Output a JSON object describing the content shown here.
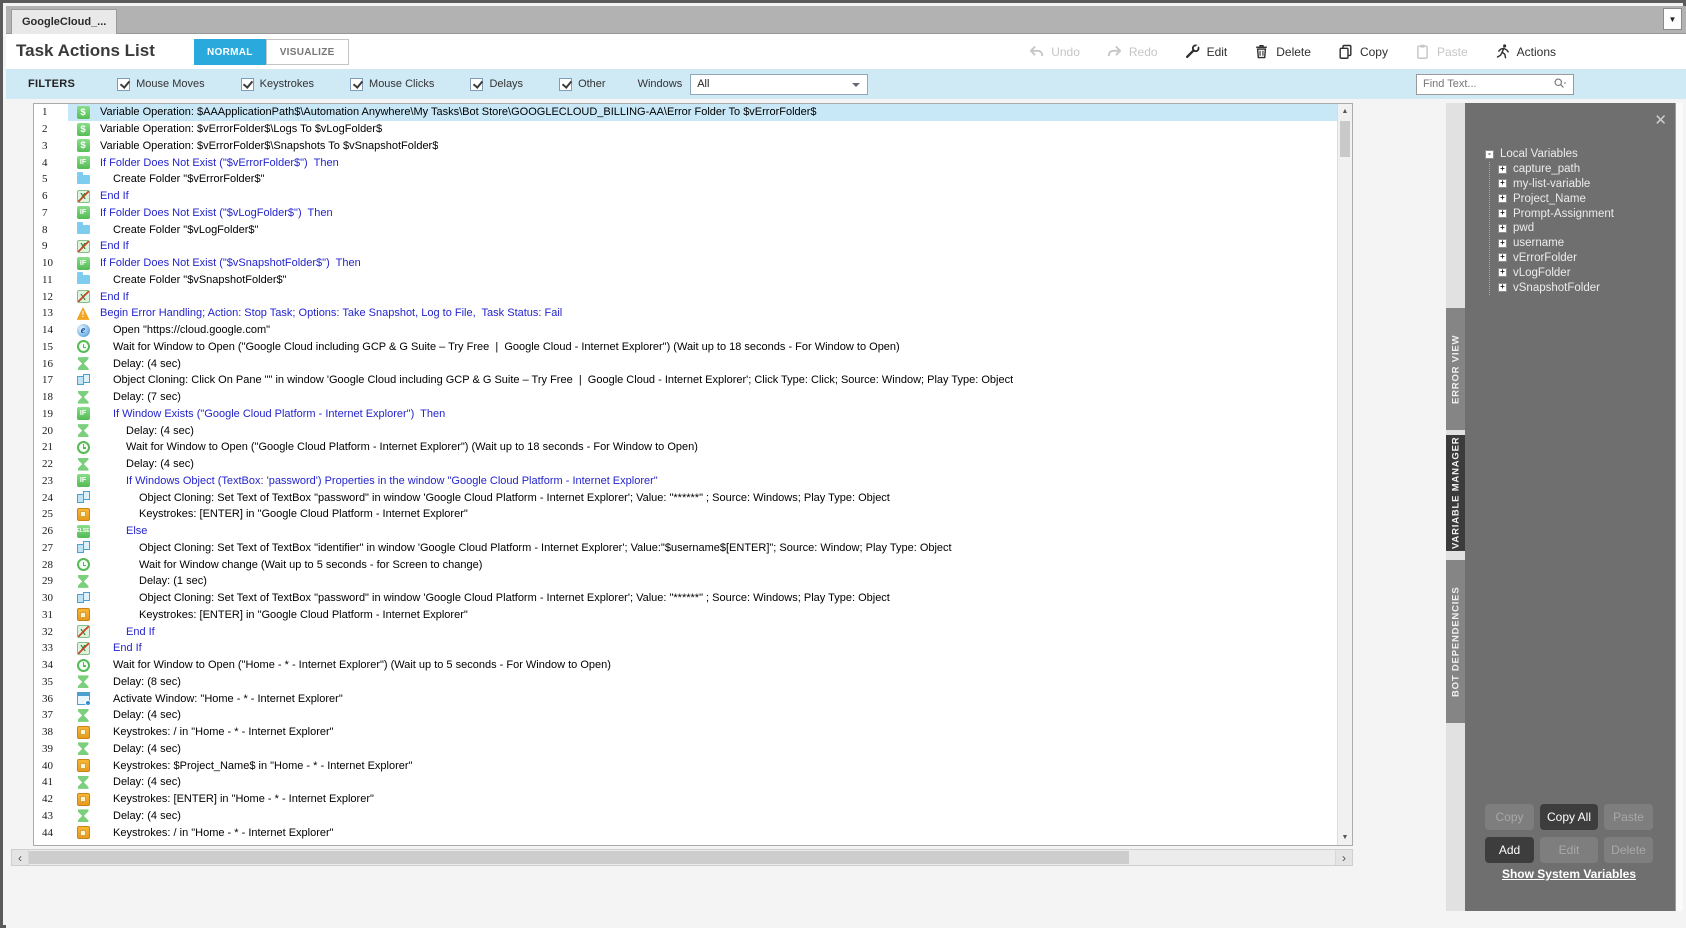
{
  "tab_bar": {
    "tab_title": "GoogleCloud_...",
    "overflow_caret": "▼"
  },
  "header": {
    "title": "Task Actions List",
    "modes": [
      {
        "label": "NORMAL",
        "active": true
      },
      {
        "label": "VISUALIZE",
        "active": false
      }
    ],
    "tools": [
      {
        "name": "undo",
        "label": "Undo",
        "enabled": false
      },
      {
        "name": "redo",
        "label": "Redo",
        "enabled": false
      },
      {
        "name": "edit",
        "label": "Edit",
        "enabled": true
      },
      {
        "name": "delete",
        "label": "Delete",
        "enabled": true
      },
      {
        "name": "copy",
        "label": "Copy",
        "enabled": true
      },
      {
        "name": "paste",
        "label": "Paste",
        "enabled": false
      },
      {
        "name": "actions",
        "label": "Actions",
        "enabled": true
      }
    ]
  },
  "filters": {
    "label": "FILTERS",
    "checkboxes": [
      {
        "label": "Mouse Moves",
        "checked": true
      },
      {
        "label": "Keystrokes",
        "checked": true
      },
      {
        "label": "Mouse Clicks",
        "checked": true
      },
      {
        "label": "Delays",
        "checked": true
      },
      {
        "label": "Other",
        "checked": true
      }
    ],
    "windows_label": "Windows",
    "windows_value": "All",
    "find_placeholder": "Find Text..."
  },
  "list": {
    "rows": [
      {
        "n": 1,
        "icon": "variable-icon",
        "indent": 0,
        "blue": false,
        "selected": true,
        "text": "Variable Operation: $AAApplicationPath$\\Automation Anywhere\\My Tasks\\Bot Store\\GOOGLECLOUD_BILLING-AA\\Error Folder To $vErrorFolder$"
      },
      {
        "n": 2,
        "icon": "variable-icon",
        "indent": 0,
        "blue": false,
        "selected": false,
        "text": "Variable Operation: $vErrorFolder$\\Logs To $vLogFolder$"
      },
      {
        "n": 3,
        "icon": "variable-icon",
        "indent": 0,
        "blue": false,
        "selected": false,
        "text": "Variable Operation: $vErrorFolder$\\Snapshots To $vSnapshotFolder$"
      },
      {
        "n": 4,
        "icon": "if-icon",
        "indent": 0,
        "blue": true,
        "selected": false,
        "text": "If Folder Does Not Exist (\"$vErrorFolder$\")  Then"
      },
      {
        "n": 5,
        "icon": "folder-icon",
        "indent": 1,
        "blue": false,
        "selected": false,
        "text": "Create Folder \"$vErrorFolder$\""
      },
      {
        "n": 6,
        "icon": "endif-icon",
        "indent": 0,
        "blue": true,
        "selected": false,
        "text": "End If"
      },
      {
        "n": 7,
        "icon": "if-icon",
        "indent": 0,
        "blue": true,
        "selected": false,
        "text": "If Folder Does Not Exist (\"$vLogFolder$\")  Then"
      },
      {
        "n": 8,
        "icon": "folder-icon",
        "indent": 1,
        "blue": false,
        "selected": false,
        "text": "Create Folder \"$vLogFolder$\""
      },
      {
        "n": 9,
        "icon": "endif-icon",
        "indent": 0,
        "blue": true,
        "selected": false,
        "text": "End If"
      },
      {
        "n": 10,
        "icon": "if-icon",
        "indent": 0,
        "blue": true,
        "selected": false,
        "text": "If Folder Does Not Exist (\"$vSnapshotFolder$\")  Then"
      },
      {
        "n": 11,
        "icon": "folder-icon",
        "indent": 1,
        "blue": false,
        "selected": false,
        "text": "Create Folder \"$vSnapshotFolder$\""
      },
      {
        "n": 12,
        "icon": "endif-icon",
        "indent": 0,
        "blue": true,
        "selected": false,
        "text": "End If"
      },
      {
        "n": 13,
        "icon": "error-handling-icon",
        "indent": 0,
        "blue": true,
        "selected": false,
        "text": "Begin Error Handling; Action: Stop Task; Options: Take Snapshot, Log to File,  Task Status: Fail"
      },
      {
        "n": 14,
        "icon": "browser-icon",
        "indent": 1,
        "blue": false,
        "selected": false,
        "text": "Open \"https://cloud.google.com\""
      },
      {
        "n": 15,
        "icon": "wait-window-icon",
        "indent": 1,
        "blue": false,
        "selected": false,
        "text": "Wait for Window to Open (\"Google Cloud including GCP & G Suite – Try Free  |  Google Cloud - Internet Explorer\") (Wait up to 18 seconds - For Window to Open)"
      },
      {
        "n": 16,
        "icon": "delay-icon",
        "indent": 1,
        "blue": false,
        "selected": false,
        "text": "Delay: (4 sec)"
      },
      {
        "n": 17,
        "icon": "object-cloning-icon",
        "indent": 1,
        "blue": false,
        "selected": false,
        "text": "Object Cloning: Click On Pane \"\" in window 'Google Cloud including GCP & G Suite – Try Free  |  Google Cloud - Internet Explorer'; Click Type: Click; Source: Window; Play Type: Object"
      },
      {
        "n": 18,
        "icon": "delay-icon",
        "indent": 1,
        "blue": false,
        "selected": false,
        "text": "Delay: (7 sec)"
      },
      {
        "n": 19,
        "icon": "if-icon",
        "indent": 1,
        "blue": true,
        "selected": false,
        "text": "If Window Exists (\"Google Cloud Platform - Internet Explorer\")  Then"
      },
      {
        "n": 20,
        "icon": "delay-icon",
        "indent": 2,
        "blue": false,
        "selected": false,
        "text": "Delay: (4 sec)"
      },
      {
        "n": 21,
        "icon": "wait-window-icon",
        "indent": 2,
        "blue": false,
        "selected": false,
        "text": "Wait for Window to Open (\"Google Cloud Platform - Internet Explorer\") (Wait up to 18 seconds - For Window to Open)"
      },
      {
        "n": 22,
        "icon": "delay-icon",
        "indent": 2,
        "blue": false,
        "selected": false,
        "text": "Delay: (4 sec)"
      },
      {
        "n": 23,
        "icon": "if-icon",
        "indent": 2,
        "blue": true,
        "selected": false,
        "text": "If Windows Object (TextBox: 'password') Properties in the window \"Google Cloud Platform - Internet Explorer\""
      },
      {
        "n": 24,
        "icon": "object-cloning-icon",
        "indent": 3,
        "blue": false,
        "selected": false,
        "text": "Object Cloning: Set Text of TextBox \"password\" in window 'Google Cloud Platform - Internet Explorer'; Value: \"******\" ; Source: Windows; Play Type: Object"
      },
      {
        "n": 25,
        "icon": "keystrokes-icon",
        "indent": 3,
        "blue": false,
        "selected": false,
        "text": "Keystrokes: [ENTER] in \"Google Cloud Platform - Internet Explorer\""
      },
      {
        "n": 26,
        "icon": "else-icon",
        "indent": 2,
        "blue": true,
        "selected": false,
        "text": "Else"
      },
      {
        "n": 27,
        "icon": "object-cloning-icon",
        "indent": 3,
        "blue": false,
        "selected": false,
        "text": "Object Cloning: Set Text of TextBox \"identifier\" in window 'Google Cloud Platform - Internet Explorer'; Value:\"$username$[ENTER]\"; Source: Window; Play Type: Object"
      },
      {
        "n": 28,
        "icon": "wait-window-icon",
        "indent": 3,
        "blue": false,
        "selected": false,
        "text": "Wait for Window change (Wait up to 5 seconds - for Screen to change)"
      },
      {
        "n": 29,
        "icon": "delay-icon",
        "indent": 3,
        "blue": false,
        "selected": false,
        "text": "Delay: (1 sec)"
      },
      {
        "n": 30,
        "icon": "object-cloning-icon",
        "indent": 3,
        "blue": false,
        "selected": false,
        "text": "Object Cloning: Set Text of TextBox \"password\" in window 'Google Cloud Platform - Internet Explorer'; Value: \"******\" ; Source: Windows; Play Type: Object"
      },
      {
        "n": 31,
        "icon": "keystrokes-icon",
        "indent": 3,
        "blue": false,
        "selected": false,
        "text": "Keystrokes: [ENTER] in \"Google Cloud Platform - Internet Explorer\""
      },
      {
        "n": 32,
        "icon": "endif-icon",
        "indent": 2,
        "blue": true,
        "selected": false,
        "text": "End If"
      },
      {
        "n": 33,
        "icon": "endif-icon",
        "indent": 1,
        "blue": true,
        "selected": false,
        "text": "End If"
      },
      {
        "n": 34,
        "icon": "wait-window-icon",
        "indent": 1,
        "blue": false,
        "selected": false,
        "text": "Wait for Window to Open (\"Home - * - Internet Explorer\") (Wait up to 5 seconds - For Window to Open)"
      },
      {
        "n": 35,
        "icon": "delay-icon",
        "indent": 1,
        "blue": false,
        "selected": false,
        "text": "Delay: (8 sec)"
      },
      {
        "n": 36,
        "icon": "activate-window-icon",
        "indent": 1,
        "blue": false,
        "selected": false,
        "text": "Activate Window: \"Home - * - Internet Explorer\""
      },
      {
        "n": 37,
        "icon": "delay-icon",
        "indent": 1,
        "blue": false,
        "selected": false,
        "text": "Delay: (4 sec)"
      },
      {
        "n": 38,
        "icon": "keystrokes-icon",
        "indent": 1,
        "blue": false,
        "selected": false,
        "text": "Keystrokes: / in \"Home - * - Internet Explorer\""
      },
      {
        "n": 39,
        "icon": "delay-icon",
        "indent": 1,
        "blue": false,
        "selected": false,
        "text": "Delay: (4 sec)"
      },
      {
        "n": 40,
        "icon": "keystrokes-icon",
        "indent": 1,
        "blue": false,
        "selected": false,
        "text": "Keystrokes: $Project_Name$ in \"Home - * - Internet Explorer\""
      },
      {
        "n": 41,
        "icon": "delay-icon",
        "indent": 1,
        "blue": false,
        "selected": false,
        "text": "Delay: (4 sec)"
      },
      {
        "n": 42,
        "icon": "keystrokes-icon",
        "indent": 1,
        "blue": false,
        "selected": false,
        "text": "Keystrokes: [ENTER] in \"Home - * - Internet Explorer\""
      },
      {
        "n": 43,
        "icon": "delay-icon",
        "indent": 1,
        "blue": false,
        "selected": false,
        "text": "Delay: (4 sec)"
      },
      {
        "n": 44,
        "icon": "keystrokes-icon",
        "indent": 1,
        "blue": false,
        "selected": false,
        "text": "Keystrokes: / in \"Home - * - Internet Explorer\""
      }
    ]
  },
  "side_tabs": [
    {
      "label": "ERROR VIEW",
      "active": false
    },
    {
      "label": "VARIABLE MANAGER",
      "active": true
    },
    {
      "label": "BOT DEPENDENCIES",
      "active": false
    }
  ],
  "variable_manager": {
    "close_glyph": "✕",
    "root_label": "Local Variables",
    "variables": [
      "capture_path",
      "my-list-variable",
      "Project_Name",
      "Prompt-Assignment",
      "pwd",
      "username",
      "vErrorFolder",
      "vLogFolder",
      "vSnapshotFolder"
    ],
    "buttons": [
      {
        "label": "Copy",
        "enabled": false
      },
      {
        "label": "Copy All",
        "enabled": true
      },
      {
        "label": "Paste",
        "enabled": false
      },
      {
        "label": "Add",
        "enabled": true
      },
      {
        "label": "Edit",
        "enabled": false
      },
      {
        "label": "Delete",
        "enabled": false
      }
    ],
    "link": "Show System Variables"
  },
  "colors": {
    "accent": "#2aa9dd",
    "selection": "#c9e8f7",
    "blue_text": "#2424cc",
    "filters_bg": "#cfe9f5",
    "panel_bg": "#6f6f6f"
  }
}
